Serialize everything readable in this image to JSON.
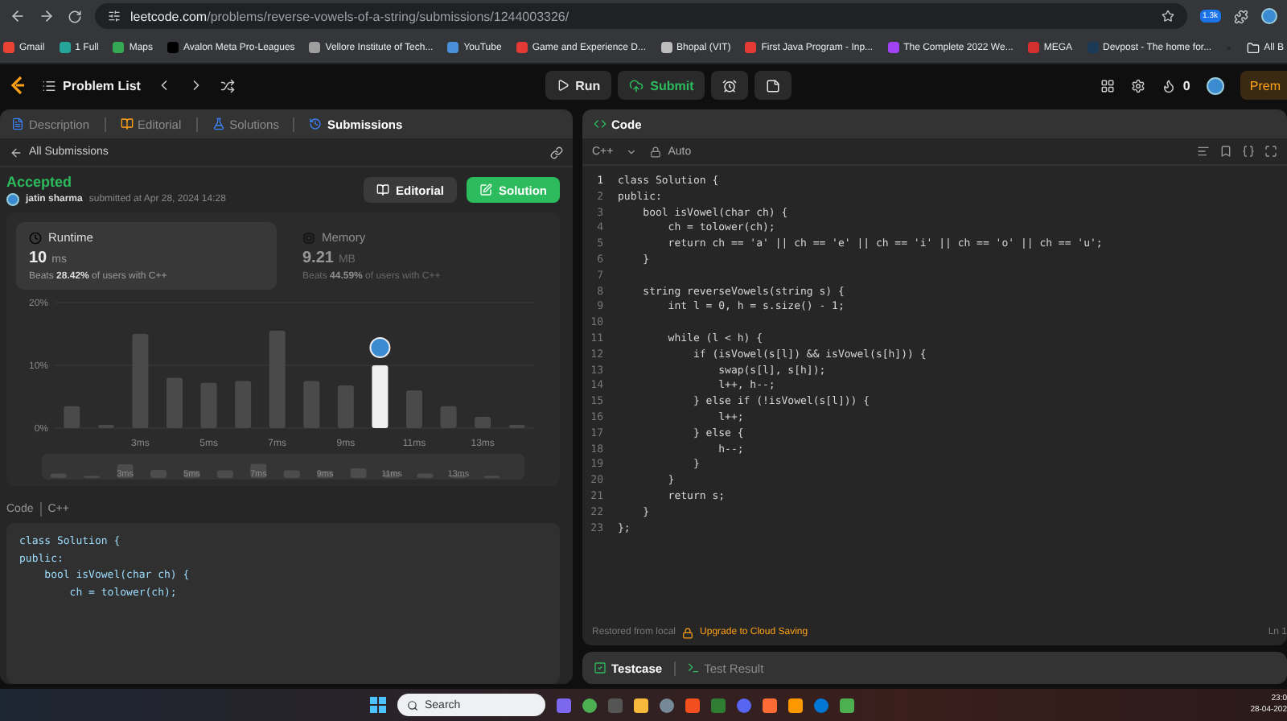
{
  "browser": {
    "url_host": "leetcode.com",
    "url_path": "/problems/reverse-vowels-of-a-string/submissions/1244003326/",
    "extension_badge": "1.3k",
    "bookmarks": [
      {
        "label": "Gmail",
        "color": "#ea4335"
      },
      {
        "label": "1 Full",
        "color": "#26a69a"
      },
      {
        "label": "Maps",
        "color": "#34a853"
      },
      {
        "label": "Avalon Meta Pro-Leagues",
        "color": "#000000"
      },
      {
        "label": "Vellore Institute of Tech...",
        "color": "#9e9e9e"
      },
      {
        "label": "YouTube",
        "color": "#4a90d9"
      },
      {
        "label": "Game and Experience D...",
        "color": "#e53935"
      },
      {
        "label": "Bhopal (VIT)",
        "color": "#bdbdbd"
      },
      {
        "label": "First Java Program - Inp...",
        "color": "#e53935"
      },
      {
        "label": "The Complete 2022 We...",
        "color": "#a142f4"
      },
      {
        "label": "MEGA",
        "color": "#d32f2f"
      },
      {
        "label": "Devpost - The home for...",
        "color": "#1b3a57"
      }
    ],
    "all_bookmarks": "All B"
  },
  "nav": {
    "problem_list": "Problem List",
    "run": "Run",
    "submit": "Submit",
    "streak": "0",
    "premium": "Prem"
  },
  "left_tabs": [
    {
      "label": "Description",
      "selected": false
    },
    {
      "label": "Editorial",
      "selected": false
    },
    {
      "label": "Solutions",
      "selected": false
    },
    {
      "label": "Submissions",
      "selected": true
    }
  ],
  "back_link": "All Submissions",
  "submission": {
    "status": "Accepted",
    "user": "jatin sharma",
    "submitted": "submitted at Apr 28, 2024 14:28",
    "editorial_button": "Editorial",
    "solution_button": "Solution",
    "runtime": {
      "label": "Runtime",
      "value": "10",
      "unit": "ms",
      "beats_prefix": "Beats",
      "beats": "28.42%",
      "beats_suffix": "of users with C++",
      "selected": true
    },
    "memory": {
      "label": "Memory",
      "value": "9.21",
      "unit": "MB",
      "beats_prefix": "Beats",
      "beats": "44.59%",
      "beats_suffix": "of users with C++",
      "selected": false
    },
    "chart_data": {
      "type": "bar",
      "x": [
        1,
        2,
        3,
        4,
        5,
        6,
        7,
        8,
        9,
        10,
        11,
        12,
        13,
        14
      ],
      "series": [
        {
          "color": "#4a4a4a",
          "values": [
            3.5,
            0.5,
            15,
            8,
            7.2,
            7.5,
            15.5,
            7.5,
            6.8,
            null,
            6,
            3.5,
            1.8,
            0.5
          ]
        },
        {
          "color": "#f0f0f0",
          "values": [
            null,
            null,
            null,
            null,
            null,
            null,
            null,
            null,
            null,
            10,
            null,
            null,
            null,
            null
          ]
        }
      ],
      "xlim": [
        0.5,
        14.5
      ],
      "xticks": [
        {
          "value": 3,
          "label": "3ms"
        },
        {
          "value": 5,
          "label": "5ms"
        },
        {
          "value": 7,
          "label": "7ms"
        },
        {
          "value": 9,
          "label": "9ms"
        },
        {
          "value": 11,
          "label": "11ms"
        },
        {
          "value": 13,
          "label": "13ms"
        }
      ],
      "yticks": [
        {
          "value": 0,
          "label": "0%"
        },
        {
          "value": 10,
          "label": "10%"
        },
        {
          "value": 20,
          "label": "20%"
        }
      ],
      "ylim": [
        0,
        20
      ]
    },
    "overview_labels": [
      "3ms",
      "5ms",
      "7ms",
      "9ms",
      "11ms",
      "13ms"
    ],
    "code_label": "Code",
    "language": "C++",
    "code_preview": [
      "class Solution {",
      "public:",
      "    bool isVowel(char ch) {",
      "        ch = tolower(ch);"
    ]
  },
  "editor": {
    "tab": "Code",
    "language": "C++",
    "mode": "Auto",
    "lines": [
      {
        "number": "1",
        "text": "class Solution {"
      },
      {
        "number": "2",
        "text": "public:"
      },
      {
        "number": "3",
        "text": "    bool isVowel(char ch) {"
      },
      {
        "number": "4",
        "text": "        ch = tolower(ch);"
      },
      {
        "number": "5",
        "text": "        return ch == 'a' || ch == 'e' || ch == 'i' || ch == 'o' || ch == 'u';"
      },
      {
        "number": "6",
        "text": "    }"
      },
      {
        "number": "7"
      },
      {
        "number": "8",
        "text": "    string reverseVowels(string s) {"
      },
      {
        "number": "9",
        "text": "        int l = 0, h = s.size() - 1;"
      },
      {
        "number": "10"
      },
      {
        "number": "11",
        "text": "        while (l < h) {"
      },
      {
        "number": "12",
        "text": "            if (isVowel(s[l]) && isVowel(s[h])) {"
      },
      {
        "number": "13",
        "text": "                swap(s[l], s[h]);"
      },
      {
        "number": "14",
        "text": "                l++, h--;"
      },
      {
        "number": "15",
        "text": "            } else if (!isVowel(s[l])) {"
      },
      {
        "number": "16",
        "text": "                l++;"
      },
      {
        "number": "17",
        "text": "            } else {"
      },
      {
        "number": "18",
        "text": "                h--;"
      },
      {
        "number": "19",
        "text": "            }"
      },
      {
        "number": "20",
        "text": "        }"
      },
      {
        "number": "21",
        "text": "        return s;"
      },
      {
        "number": "22",
        "text": "    }"
      },
      {
        "number": "23",
        "text": "};"
      }
    ],
    "restored": "Restored from local",
    "upgrade": "Upgrade to Cloud Saving",
    "cursor": "Ln 1"
  },
  "bottom_tabs": [
    {
      "label": "Testcase",
      "selected": true
    },
    {
      "label": "Test Result",
      "selected": false
    }
  ],
  "taskbar": {
    "search": "Search",
    "time": "23:0",
    "date": "28-04-202"
  }
}
